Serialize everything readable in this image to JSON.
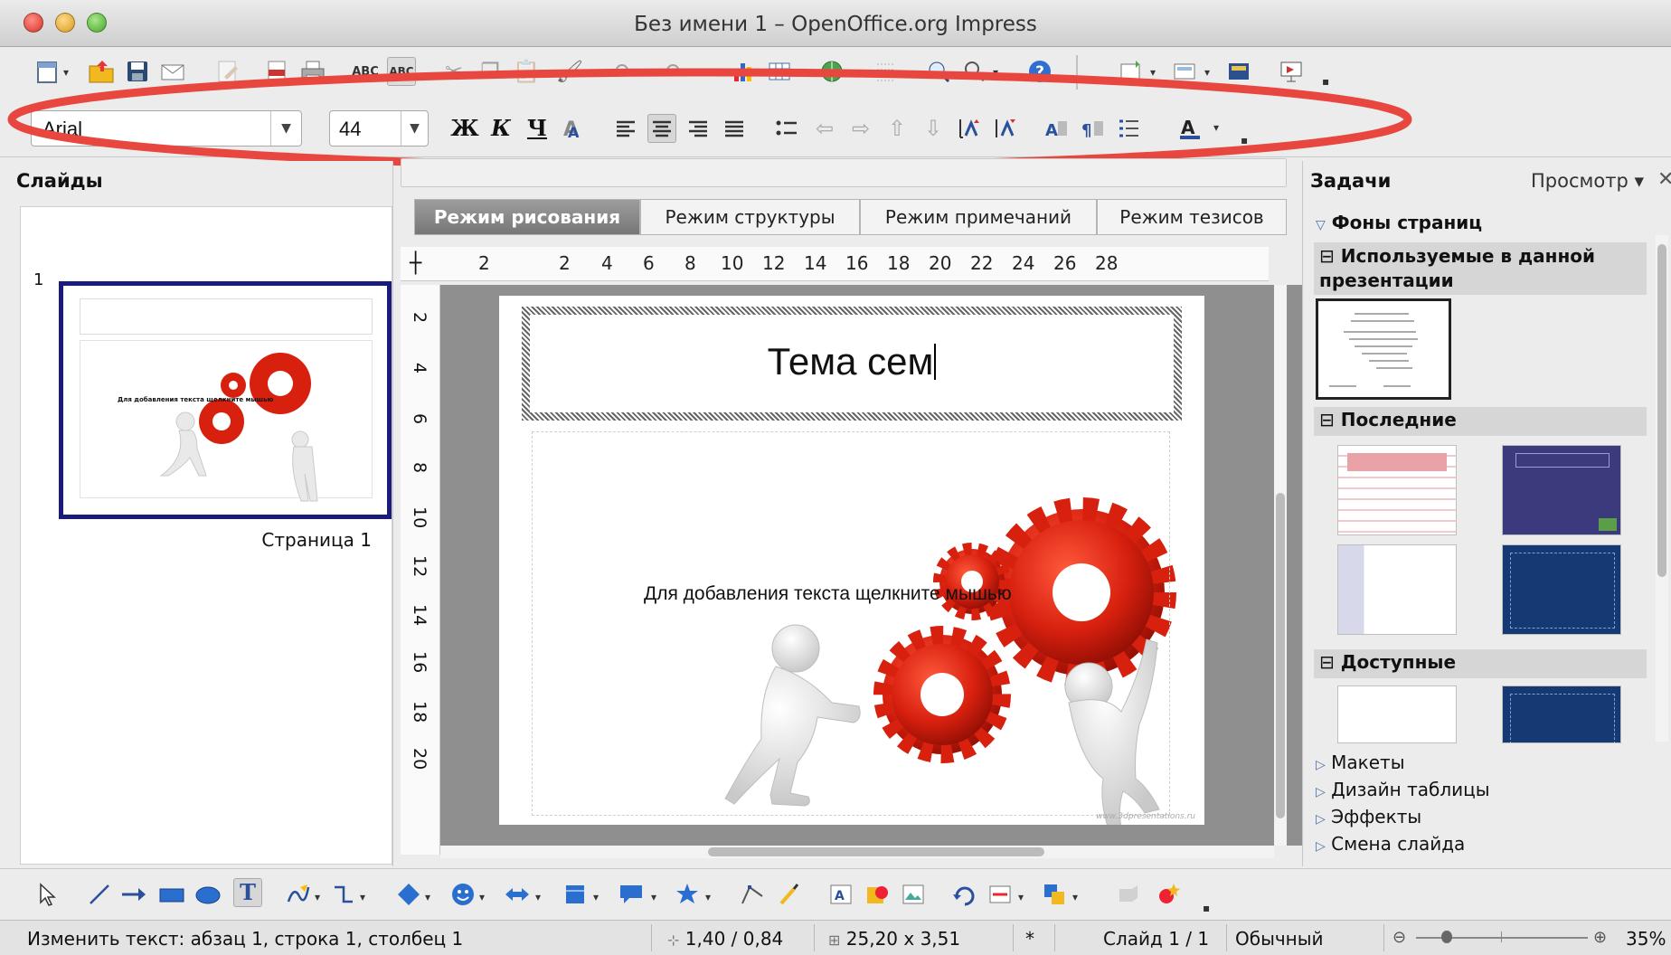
{
  "window": {
    "title": "Без имени 1 – OpenOffice.org Impress"
  },
  "formatting": {
    "font_name": "Arial",
    "font_size": "44",
    "bold_glyph": "Ж",
    "italic_glyph": "К",
    "underline_glyph": "Ч"
  },
  "slides_pane": {
    "header": "Слайды",
    "slide_number": "1",
    "thumb_label": "Страница 1",
    "thumb_text": "Для добавления текста щелкните мышью"
  },
  "view_tabs": [
    {
      "label": "Режим рисования",
      "active": true
    },
    {
      "label": "Режим структуры",
      "active": false
    },
    {
      "label": "Режим примечаний",
      "active": false
    },
    {
      "label": "Режим тезисов",
      "active": false
    }
  ],
  "ruler": {
    "horizontal": [
      "2",
      "2",
      "4",
      "6",
      "8",
      "10",
      "12",
      "14",
      "16",
      "18",
      "20",
      "22",
      "24",
      "26",
      "28"
    ],
    "vertical": [
      "2",
      "4",
      "6",
      "8",
      "10",
      "12",
      "14",
      "16",
      "18",
      "20"
    ]
  },
  "slide": {
    "title": "Тема сем",
    "body": "Для добавления текста щелкните мышью",
    "watermark": "www.3dpresentations.ru"
  },
  "tasks_pane": {
    "header": "Задачи",
    "view_menu": "Просмотр",
    "master_pages": "Фоны страниц",
    "used": "Используемые в данной презентации",
    "recent": "Последние",
    "available": "Доступные",
    "links": [
      "Макеты",
      "Дизайн таблицы",
      "Эффекты",
      "Смена слайда"
    ]
  },
  "statusbar": {
    "message": "Изменить текст: абзац 1, строка 1, столбец 1",
    "position": "1,40 / 0,84",
    "size": "25,20 x 3,51",
    "modified": "*",
    "slide_info": "Слайд 1 / 1",
    "layout": "Обычный",
    "zoom": "35%"
  },
  "colors": {
    "annotation": "#e8473f",
    "slide_selection_border": "#1a1b7a",
    "gear_red": "#d8200f",
    "active_tab": "#858585"
  }
}
